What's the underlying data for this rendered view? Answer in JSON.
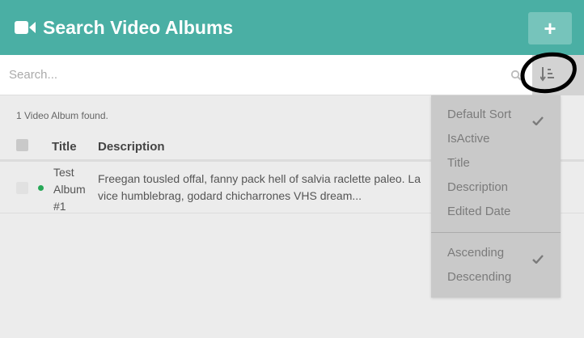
{
  "header": {
    "title": "Search Video Albums",
    "icon": "video-camera-icon",
    "add_label": "+"
  },
  "search": {
    "placeholder": "Search...",
    "value": "",
    "search_icon": "search-icon",
    "sort_icon": "sort-icon"
  },
  "results": {
    "count_text": "1 Video Album found."
  },
  "table": {
    "columns": {
      "title": "Title",
      "description": "Description"
    },
    "rows": [
      {
        "title": "Test Album #1",
        "status": "active",
        "status_color": "#27a857",
        "description_line1": "Freegan tousled offal, fanny pack hell of salvia raclette paleo. La",
        "description_line2": "vice humblebrag, godard chicharrones VHS dream..."
      }
    ]
  },
  "sort_menu": {
    "fields": [
      {
        "label": "Default Sort",
        "checked": true
      },
      {
        "label": "IsActive",
        "checked": false
      },
      {
        "label": "Title",
        "checked": false
      },
      {
        "label": "Description",
        "checked": false
      },
      {
        "label": "Edited Date",
        "checked": false
      }
    ],
    "orders": [
      {
        "label": "Ascending",
        "checked": true
      },
      {
        "label": "Descending",
        "checked": false
      }
    ]
  },
  "colors": {
    "header": "#4aafa4",
    "add_button": "#76c4bb",
    "dropdown": "#c9c9c9",
    "active_dot": "#27a857",
    "annotation": "#000000"
  }
}
